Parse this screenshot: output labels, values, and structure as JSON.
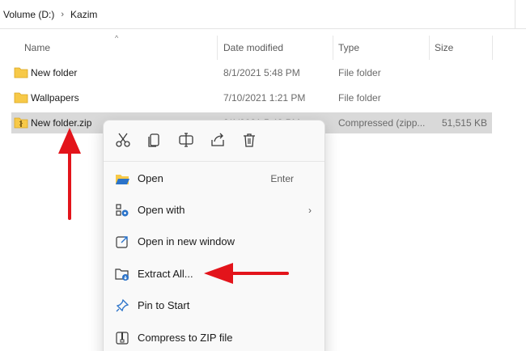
{
  "breadcrumb": {
    "drive": "Volume (D:)",
    "separator": "›",
    "folder": "Kazim"
  },
  "columns": {
    "name": "Name",
    "date": "Date modified",
    "type": "Type",
    "size": "Size"
  },
  "files": [
    {
      "name": "New folder",
      "date": "8/1/2021 5:48 PM",
      "type": "File folder",
      "size": "",
      "icon": "folder-icon"
    },
    {
      "name": "Wallpapers",
      "date": "7/10/2021 1:21 PM",
      "type": "File folder",
      "size": "",
      "icon": "folder-icon"
    },
    {
      "name": "New folder.zip",
      "date": "8/1/2021 5:48 PM",
      "type": "Compressed (zipp...",
      "size": "51,515 KB",
      "icon": "zip-folder-icon",
      "selected": true
    }
  ],
  "context_menu": {
    "quick_actions": [
      "cut-icon",
      "copy-icon",
      "rename-icon",
      "share-icon",
      "delete-icon"
    ],
    "items": [
      {
        "label": "Open",
        "shortcut": "Enter",
        "icon": "folder-open-icon"
      },
      {
        "label": "Open with",
        "submenu": "›",
        "icon": "open-with-icon"
      },
      {
        "label": "Open in new window",
        "icon": "new-window-icon"
      },
      {
        "label": "Extract All...",
        "icon": "extract-icon"
      },
      {
        "label": "Pin to Start",
        "icon": "pin-icon"
      },
      {
        "label": "Compress to ZIP file",
        "icon": "compress-icon"
      }
    ]
  },
  "colors": {
    "arrow": "#e3141b",
    "folder": "#f7c948",
    "accent": "#2b73c9",
    "selection": "#d9d9d9"
  }
}
